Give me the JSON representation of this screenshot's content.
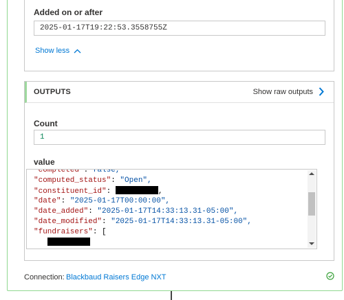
{
  "inputs": {
    "added_on_label": "Added on or after",
    "added_on_value": "2025-01-17T19:22:53.3558755Z",
    "show_less": "Show less"
  },
  "outputs": {
    "title": "OUTPUTS",
    "show_raw": "Show raw outputs",
    "count_label": "Count",
    "count_value": "1",
    "value_label": "value",
    "json_lines": [
      {
        "key": "\"completed\"",
        "sep": ": ",
        "val": "false,"
      },
      {
        "key": "\"computed_status\"",
        "sep": ": ",
        "val": "\"Open\","
      },
      {
        "key": "\"constituent_id\"",
        "sep": ": ",
        "val": "[redacted]"
      },
      {
        "key": "\"date\"",
        "sep": ": ",
        "val": "\"2025-01-17T00:00:00\","
      },
      {
        "key": "\"date_added\"",
        "sep": ": ",
        "val": "\"2025-01-17T14:33:13.31-05:00\","
      },
      {
        "key": "\"date_modified\"",
        "sep": ": ",
        "val": "\"2025-01-17T14:33:13.31-05:00\","
      },
      {
        "key": "\"fundraisers\"",
        "sep": ": ",
        "val": "["
      },
      {
        "key": "",
        "sep": "",
        "val": "[redacted]"
      }
    ]
  },
  "footer": {
    "connection_label": "Connection:",
    "connection_name": "Blackbaud Raisers Edge NXT"
  },
  "colors": {
    "accent": "#0078d4",
    "success": "#3aa13a",
    "json_key": "#a31515",
    "json_value": "#0451a5"
  }
}
